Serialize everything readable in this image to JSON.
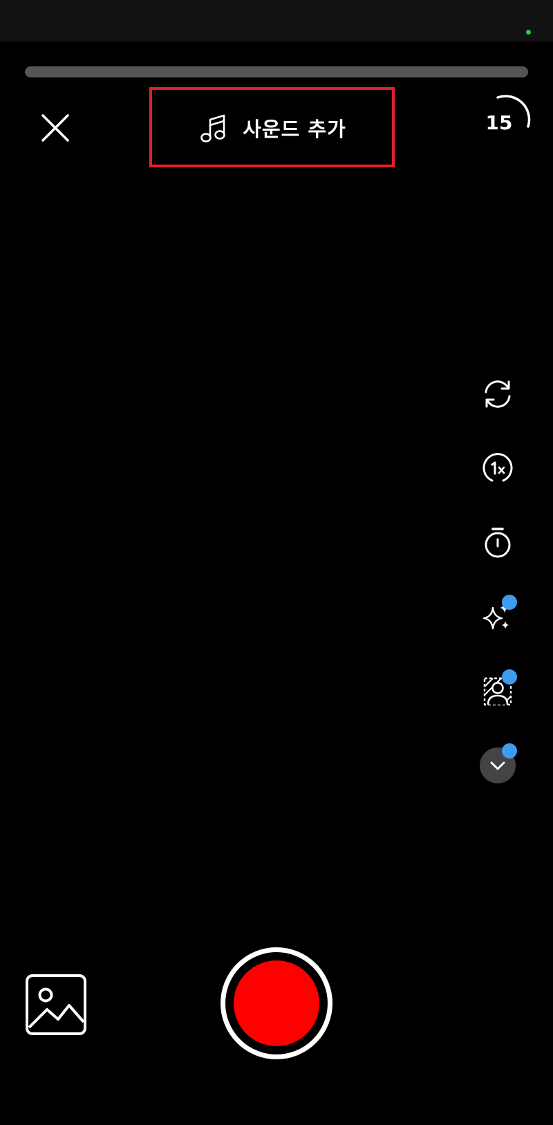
{
  "status_bar": {
    "camera_indicator_color": "#2ecc40"
  },
  "progress": {
    "fraction": 0
  },
  "top_bar": {
    "close_icon": "close-icon",
    "add_sound_label": "사운드 추가",
    "add_sound_icon": "music-note-icon",
    "duration_label": "15",
    "highlight_color": "#e3202a"
  },
  "side_tools": [
    {
      "name": "flip-camera",
      "icon": "flip-camera-icon",
      "has_new_badge": false
    },
    {
      "name": "speed",
      "icon": "speed-1x-icon",
      "has_new_badge": false
    },
    {
      "name": "timer",
      "icon": "timer-icon",
      "has_new_badge": false
    },
    {
      "name": "effects",
      "icon": "sparkles-icon",
      "has_new_badge": true
    },
    {
      "name": "green-screen",
      "icon": "green-screen-icon",
      "has_new_badge": true
    },
    {
      "name": "more",
      "icon": "chevron-down-icon",
      "has_new_badge": true
    }
  ],
  "colors": {
    "badge": "#3d9cf0",
    "record": "#ff0000",
    "background": "#000000"
  },
  "bottom_bar": {
    "gallery_icon": "gallery-icon",
    "record_icon": "record-button-icon"
  }
}
